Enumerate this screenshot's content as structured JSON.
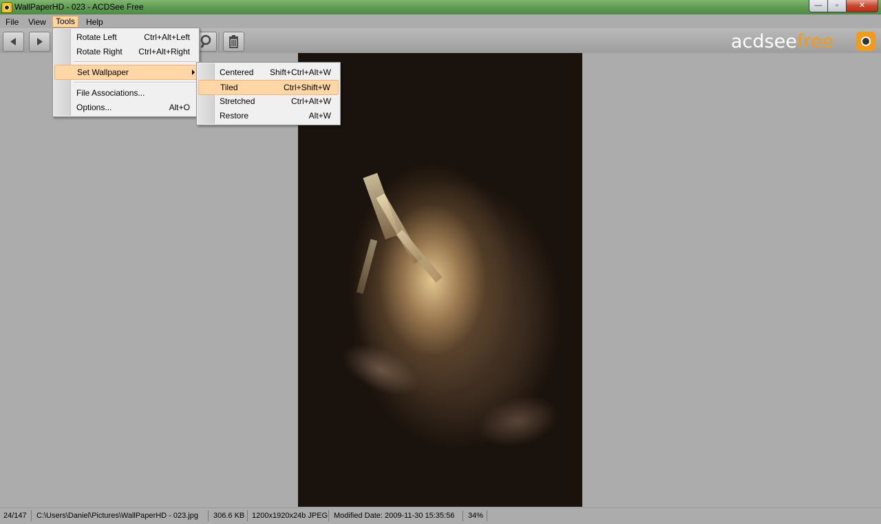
{
  "window": {
    "title": "WallPaperHD - 023 - ACDSee Free",
    "min_glyph": "—",
    "max_glyph": "▫",
    "close_glyph": "✕"
  },
  "menubar": [
    "File",
    "View",
    "Tools",
    "Help"
  ],
  "logo": {
    "part1": "acdsee",
    "part2": "free"
  },
  "tools_menu": {
    "items": [
      {
        "label": "Rotate Left",
        "shortcut": "Ctrl+Alt+Left"
      },
      {
        "label": "Rotate Right",
        "shortcut": "Ctrl+Alt+Right"
      },
      {
        "label": "Set Wallpaper",
        "shortcut": ""
      },
      {
        "label": "File Associations...",
        "shortcut": ""
      },
      {
        "label": "Options...",
        "shortcut": "Alt+O"
      }
    ]
  },
  "wallpaper_submenu": {
    "items": [
      {
        "label": "Centered",
        "shortcut": "Shift+Ctrl+Alt+W"
      },
      {
        "label": "Tiled",
        "shortcut": "Ctrl+Shift+W"
      },
      {
        "label": "Stretched",
        "shortcut": "Ctrl+Alt+W"
      },
      {
        "label": "Restore",
        "shortcut": "Alt+W"
      }
    ]
  },
  "status": {
    "index": "24/147",
    "path": "C:\\Users\\Daniel\\Pictures\\WallPaperHD - 023.jpg",
    "size": "306.6 KB",
    "dimensions": "1200x1920x24b JPEG",
    "modified": "Modified Date: 2009-11-30 15:35:56",
    "zoom": "34%"
  },
  "colors": {
    "menu_highlight": "#ffd7a6",
    "logo_orange": "#f29a1b",
    "titlebar_green": "#5e9a52"
  }
}
